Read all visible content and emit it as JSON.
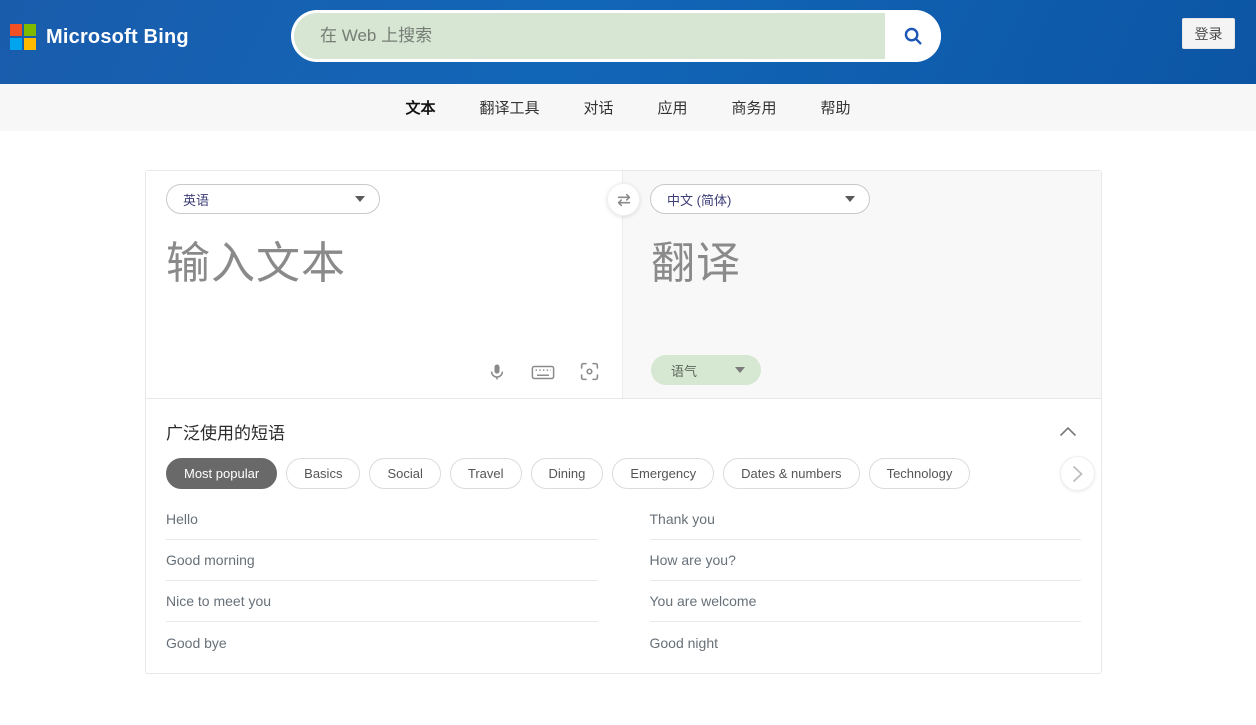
{
  "header": {
    "brand": "Microsoft Bing",
    "search_placeholder": "在 Web 上搜索",
    "sign_in_label": "登录"
  },
  "nav": {
    "tabs": [
      "文本",
      "翻译工具",
      "对话",
      "应用",
      "商务用",
      "帮助"
    ],
    "active_tab": "文本"
  },
  "translator": {
    "source_language": "英语",
    "target_language": "中文 (简体)",
    "input_placeholder": "输入文本",
    "output_placeholder": "翻译",
    "tone_label": "语气",
    "icons": [
      "microphone-icon",
      "keyboard-icon",
      "ocr-camera-icon",
      "swap-languages-icon"
    ]
  },
  "phrases": {
    "title": "广泛使用的短语",
    "selected_category": "Most popular",
    "categories": [
      "Most popular",
      "Basics",
      "Social",
      "Travel",
      "Dining",
      "Emergency",
      "Dates & numbers",
      "Technology"
    ],
    "items_left": [
      "Hello",
      "Good morning",
      "Nice to meet you",
      "Good bye"
    ],
    "items_right": [
      "Thank you",
      "How are you?",
      "You are welcome",
      "Good night"
    ]
  },
  "colors": {
    "header_blue_start": "#1a5cac",
    "header_blue_end": "#0c55a4",
    "search_green": "#d6e6d3",
    "tone_green": "#d6e8d1",
    "chip_selected_bg": "#696969",
    "ms_logo": [
      "#f25022",
      "#7fba00",
      "#00a4ef",
      "#ffb900"
    ],
    "search_icon_blue": "#1b55b5"
  }
}
